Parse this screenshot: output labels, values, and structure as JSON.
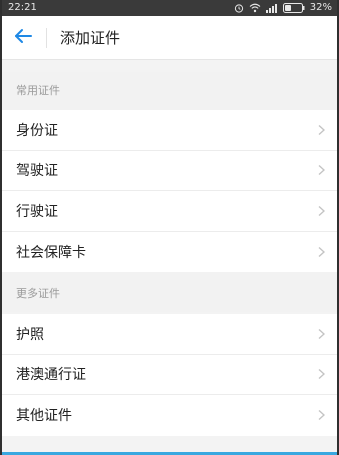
{
  "status_bar": {
    "time": "22:21",
    "battery": "32%",
    "icons": [
      "alarm-icon",
      "wifi-icon",
      "signal-icon",
      "battery-icon"
    ]
  },
  "header": {
    "back_icon": "arrow-left-icon",
    "title": "添加证件"
  },
  "sections": [
    {
      "title": "常用证件",
      "items": [
        {
          "label": "身份证"
        },
        {
          "label": "驾驶证"
        },
        {
          "label": "行驶证"
        },
        {
          "label": "社会保障卡"
        }
      ]
    },
    {
      "title": "更多证件",
      "items": [
        {
          "label": "护照"
        },
        {
          "label": "港澳通行证"
        },
        {
          "label": "其他证件"
        }
      ]
    }
  ],
  "colors": {
    "accent": "#1e88e5",
    "background": "#f2f2f2",
    "section_text": "#9a9a9a",
    "item_text": "#222222",
    "chevron": "#c4c4c4"
  }
}
